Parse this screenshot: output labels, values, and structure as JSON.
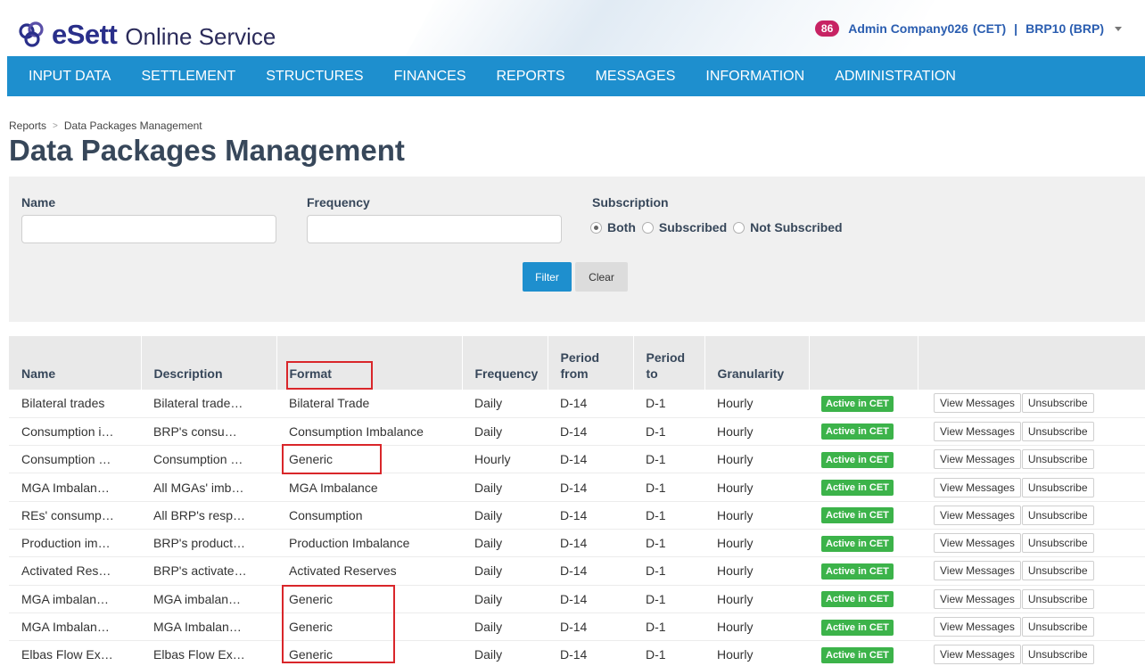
{
  "header": {
    "brand": "eSett",
    "subtitle": "Online Service",
    "notification_count": "86",
    "user": "Admin Company026",
    "timezone": "(CET)",
    "separator": "|",
    "role": "BRP10 (BRP)",
    "brand_color": "#2a2f8a"
  },
  "nav": {
    "items": [
      "INPUT DATA",
      "SETTLEMENT",
      "STRUCTURES",
      "FINANCES",
      "REPORTS",
      "MESSAGES",
      "INFORMATION",
      "ADMINISTRATION"
    ],
    "color": "#1e8fce"
  },
  "breadcrumb": {
    "parent": "Reports",
    "current": "Data Packages Management"
  },
  "page_title": "Data Packages Management",
  "filter": {
    "name_label": "Name",
    "name_value": "",
    "frequency_label": "Frequency",
    "frequency_value": "",
    "subscription_label": "Subscription",
    "options": [
      "Both",
      "Subscribed",
      "Not Subscribed"
    ],
    "selected_option": "Both",
    "filter_button": "Filter",
    "clear_button": "Clear"
  },
  "table": {
    "columns": [
      "Name",
      "Description",
      "Format",
      "Frequency",
      "Period from",
      "Period to",
      "Granularity",
      "",
      ""
    ],
    "columns_display": {
      "name": "Name",
      "description": "Description",
      "format": "Format",
      "frequency": "Frequency",
      "period_from_1": "Period",
      "period_from_2": "from",
      "period_to_1": "Period",
      "period_to_2": "to",
      "granularity": "Granularity"
    },
    "rows": [
      {
        "name": "Bilateral trades",
        "description": "Bilateral trade…",
        "format": "Bilateral Trade",
        "frequency": "Daily",
        "from": "D-14",
        "to": "D-1",
        "granularity": "Hourly",
        "status": "Active in CET",
        "view": "View Messages",
        "unsub": "Unsubscribe"
      },
      {
        "name": "Consumption i…",
        "description": "BRP's consu…",
        "format": "Consumption Imbalance",
        "frequency": "Daily",
        "from": "D-14",
        "to": "D-1",
        "granularity": "Hourly",
        "status": "Active in CET",
        "view": "View Messages",
        "unsub": "Unsubscribe"
      },
      {
        "name": "Consumption …",
        "description": "Consumption …",
        "format": "Generic",
        "frequency": "Hourly",
        "from": "D-14",
        "to": "D-1",
        "granularity": "Hourly",
        "status": "Active in CET",
        "view": "View Messages",
        "unsub": "Unsubscribe"
      },
      {
        "name": "MGA Imbalan…",
        "description": "All MGAs' imb…",
        "format": "MGA Imbalance",
        "frequency": "Daily",
        "from": "D-14",
        "to": "D-1",
        "granularity": "Hourly",
        "status": "Active in CET",
        "view": "View Messages",
        "unsub": "Unsubscribe"
      },
      {
        "name": "REs' consump…",
        "description": "All BRP's resp…",
        "format": "Consumption",
        "frequency": "Daily",
        "from": "D-14",
        "to": "D-1",
        "granularity": "Hourly",
        "status": "Active in CET",
        "view": "View Messages",
        "unsub": "Unsubscribe"
      },
      {
        "name": "Production im…",
        "description": "BRP's product…",
        "format": "Production Imbalance",
        "frequency": "Daily",
        "from": "D-14",
        "to": "D-1",
        "granularity": "Hourly",
        "status": "Active in CET",
        "view": "View Messages",
        "unsub": "Unsubscribe"
      },
      {
        "name": "Activated Res…",
        "description": "BRP's activate…",
        "format": "Activated Reserves",
        "frequency": "Daily",
        "from": "D-14",
        "to": "D-1",
        "granularity": "Hourly",
        "status": "Active in CET",
        "view": "View Messages",
        "unsub": "Unsubscribe"
      },
      {
        "name": "MGA imbalan…",
        "description": "MGA imbalan…",
        "format": "Generic",
        "frequency": "Daily",
        "from": "D-14",
        "to": "D-1",
        "granularity": "Hourly",
        "status": "Active in CET",
        "view": "View Messages",
        "unsub": "Unsubscribe"
      },
      {
        "name": "MGA Imbalan…",
        "description": "MGA Imbalan…",
        "format": "Generic",
        "frequency": "Daily",
        "from": "D-14",
        "to": "D-1",
        "granularity": "Hourly",
        "status": "Active in CET",
        "view": "View Messages",
        "unsub": "Unsubscribe"
      },
      {
        "name": "Elbas Flow Ex…",
        "description": "Elbas Flow Ex…",
        "format": "Generic",
        "frequency": "Daily",
        "from": "D-14",
        "to": "D-1",
        "granularity": "Hourly",
        "status": "Active in CET",
        "view": "View Messages",
        "unsub": "Unsubscribe"
      }
    ],
    "status_color": "#3cb34a"
  },
  "highlight_color": "#d9262a"
}
